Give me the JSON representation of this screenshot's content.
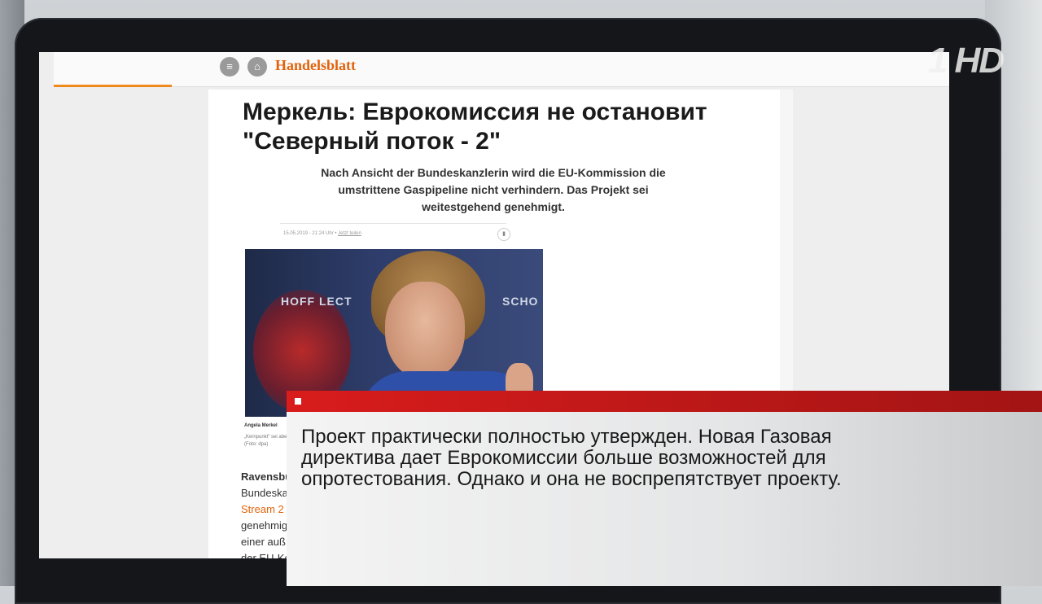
{
  "site": {
    "logo": "Handelsblatt",
    "menu_icon": "menu-icon",
    "home_icon": "home-icon"
  },
  "article": {
    "title": "Меркель: Еврокомиссия не остановит \"Северный поток - 2\"",
    "lead": "Nach Ansicht der Bundeskanzlerin wird die EU-Kommission die umstrittene Gaspipeline nicht verhindern. Das Projekt sei weitestgehend genehmigt.",
    "meta": "15.05.2019 - 21:24 Uhr •",
    "meta_link": "Jetzt teilen",
    "photo_banner_left": "HOFF LECT",
    "photo_banner_right": "SCHO",
    "caption_name": "Angela Merkel",
    "caption_text": "„Kernpunkt“ sei aber …",
    "caption_source": "(Foto: dpa)",
    "body_bold": "Ravensbu",
    "body_line1": "Bundeska",
    "body_link": "Stream 2",
    "body_line3": "genehmig",
    "body_line4": "einer auß",
    "body_line5": "der EU-Ko"
  },
  "channel": {
    "logo": "1 HD"
  },
  "lower_third": {
    "text": "Проект практически полностью утвержден. Новая Газовая директива дает Еврокомиссии больше возможностей для опротестования. Однако и она не воспрепятствует проекту."
  },
  "colors": {
    "accent_orange": "#e2630c",
    "lower_third_red": "#d91c1c"
  }
}
